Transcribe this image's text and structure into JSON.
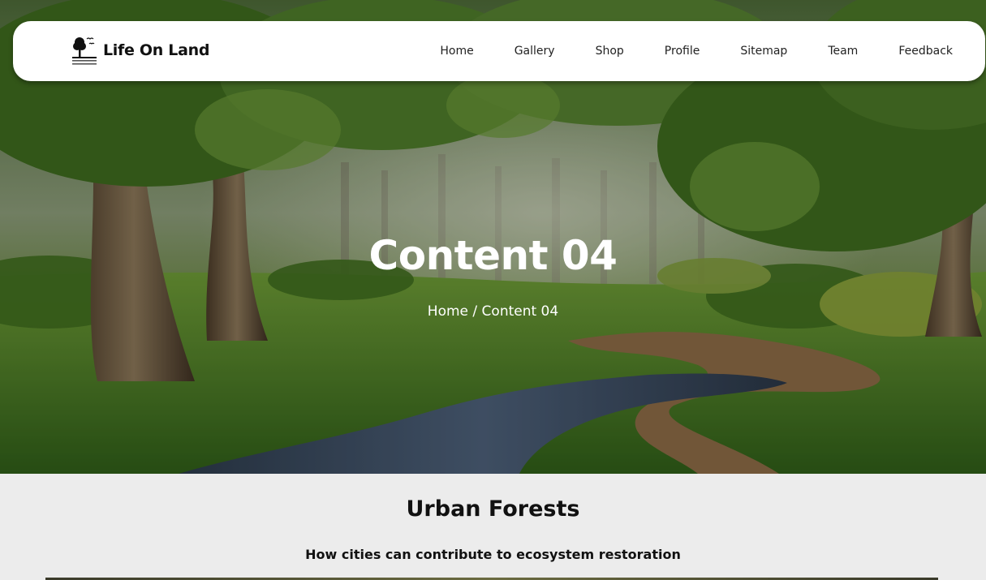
{
  "brand": {
    "name": "Life On Land"
  },
  "nav": {
    "items": [
      "Home",
      "Gallery",
      "Shop",
      "Profile",
      "Sitemap",
      "Team",
      "Feedback"
    ]
  },
  "hero": {
    "title": "Content 04",
    "breadcrumb": {
      "home": "Home",
      "separator": " / ",
      "current": "Content 04"
    }
  },
  "section": {
    "title": "Urban Forests",
    "subtitle": "How cities can contribute to ecosystem restoration"
  },
  "colors": {
    "nav_bg": "#ffffff",
    "page_bg": "#ececec",
    "text_dark": "#111111",
    "hero_text": "#ffffff"
  }
}
